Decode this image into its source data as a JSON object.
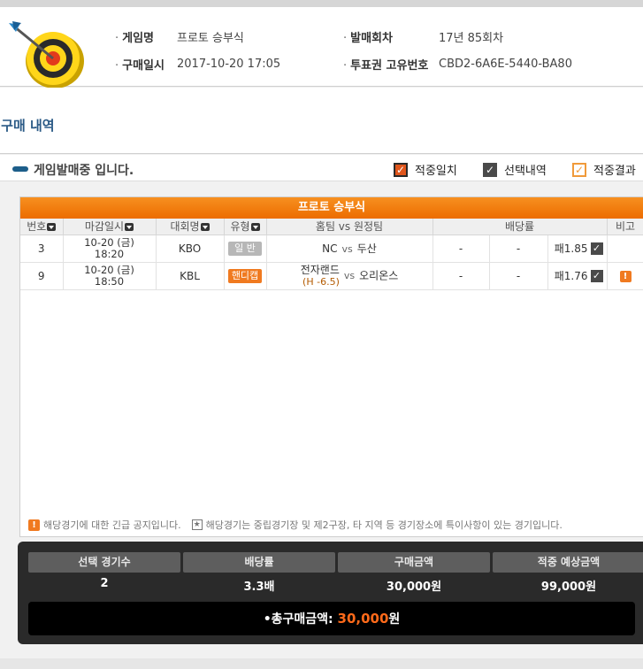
{
  "header": {
    "game_name_label": "게임명",
    "game_name": "프로토 승부식",
    "purchase_time_label": "구매일시",
    "purchase_time": "2017-10-20 17:05",
    "round_label": "발매회차",
    "round": "17년 85회차",
    "ticket_id_label": "투표권 고유번호",
    "ticket_id": "CBD2-6A6E-5440-BA80"
  },
  "section_title": "l구매 내역",
  "status": {
    "text": "게임발매중 입니다.",
    "legend": [
      {
        "label": "적중일치",
        "icon": "hit-check-icon",
        "color": "#e0561c"
      },
      {
        "label": "선택내역",
        "icon": "selected-check-icon",
        "color": "#4a4a4a"
      },
      {
        "label": "적중결과",
        "icon": "result-check-icon",
        "color": "#f09a3a"
      }
    ]
  },
  "panel": {
    "title": "프로토 승부식",
    "columns": [
      "번호",
      "마감일시",
      "대회명",
      "유형",
      "홈팀 vs 원정팀",
      "배당률",
      "비고"
    ],
    "rows": [
      {
        "no": "3",
        "date": "10-20 (금)",
        "time": "18:20",
        "league": "KBO",
        "type": "일 반",
        "home": "NC",
        "handicap": "",
        "vs": "vs",
        "away": "두산",
        "odds1": "-",
        "odds2": "-",
        "odds_label": "패1.85",
        "check": "✓",
        "note": ""
      },
      {
        "no": "9",
        "date": "10-20 (금)",
        "time": "18:50",
        "league": "KBL",
        "type": "핸디캡",
        "home": "전자랜드",
        "handicap": "(H -6.5)",
        "vs": "vs",
        "away": "오리온스",
        "odds1": "-",
        "odds2": "-",
        "odds_label": "패1.76",
        "check": "✓",
        "note": "!"
      }
    ],
    "notice_alert_text": "해당경기에 대한 긴급 공지입니다.",
    "notice_star_text": "해당경기는 중립경기장 및 제2구장, 타 지역 등 경기장소에 특이사항이 있는 경기입니다."
  },
  "summary": {
    "headers": [
      "선택 경기수",
      "배당률",
      "구매금액",
      "적중 예상금액"
    ],
    "values": [
      "2",
      "3.3배",
      "30,000원",
      "99,000원"
    ],
    "total_label": "•총구매금액:",
    "total_amount": "30,000",
    "total_unit": "원"
  }
}
